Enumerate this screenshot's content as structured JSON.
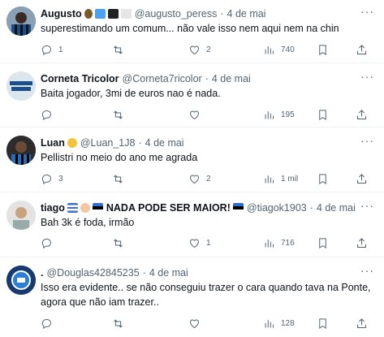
{
  "tweets": [
    {
      "name": "Augusto",
      "handle": "@augusto_peress",
      "sep": "·",
      "date": "4 de mai",
      "text": "superestimando um comum... não vale isso nem aqui nem na chin",
      "replies": "1",
      "retweets": "",
      "likes": "2",
      "views": "740"
    },
    {
      "name": "Corneta Tricolor",
      "handle": "@Corneta7ricolor",
      "sep": "·",
      "date": "4 de mai",
      "text": "Baita jogador, 3mi de euros nao é nada.",
      "replies": "",
      "retweets": "",
      "likes": "",
      "views": "195"
    },
    {
      "name": "Luan",
      "handle": "@Luan_1J8",
      "sep": "·",
      "date": "4 de mai",
      "text": "Pellistri no meio do ano me agrada",
      "replies": "3",
      "retweets": "",
      "likes": "2",
      "views": "1 mil"
    },
    {
      "name": "tiago",
      "tagline": "NADA PODE SER MAIOR!",
      "handle": "@tiagok1903",
      "sep": "·",
      "date": "4 de mai",
      "text": "Bah 3k é foda, irmão",
      "replies": "",
      "retweets": "",
      "likes": "1",
      "views": "716"
    },
    {
      "name": ".",
      "handle": "@Douglas42845235",
      "sep": "·",
      "date": "4 de mai",
      "text": "Isso era evidente.. se não conseguiu trazer o cara quando tava na Ponte,\nagora que não iam trazer..",
      "replies": "",
      "retweets": "",
      "likes": "",
      "views": "128"
    }
  ],
  "more_glyph": "···",
  "colors": {
    "text": "#0f1419",
    "secondary": "#536471",
    "border": "#eff3f4"
  }
}
